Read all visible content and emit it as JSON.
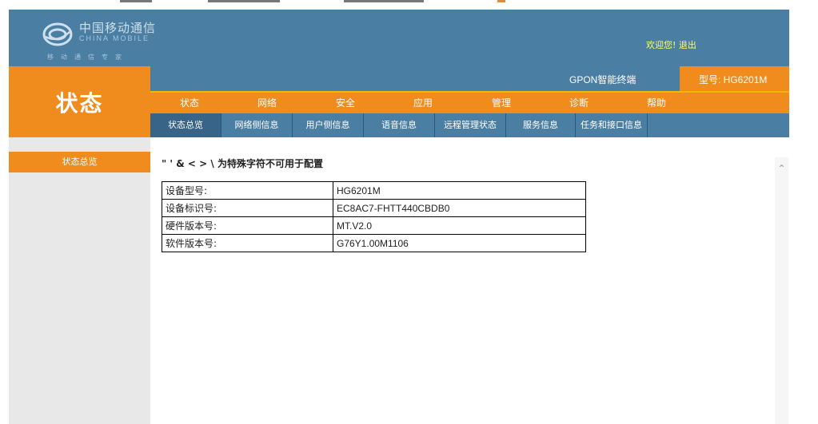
{
  "brand": {
    "name_cn": "中国移动通信",
    "name_en": "CHINA MOBILE",
    "slogan": "移动通信专家"
  },
  "header": {
    "welcome": "欢迎您!",
    "logout": "退出"
  },
  "page": {
    "title": "状态"
  },
  "product": {
    "name": "GPON智能终端",
    "model_label": "型号: HG6201M"
  },
  "main_nav": [
    "状态",
    "网络",
    "安全",
    "应用",
    "管理",
    "诊断",
    "帮助"
  ],
  "sub_nav": [
    "状态总览",
    "网络侧信息",
    "用户侧信息",
    "语音信息",
    "远程管理状态",
    "服务信息",
    "任务和接口信息"
  ],
  "sidebar": {
    "items": [
      "状态总览"
    ]
  },
  "content": {
    "notice": "\" ' & < > \\ 为特殊字符不可用于配置",
    "rows": [
      {
        "key": "设备型号:",
        "value": "HG6201M"
      },
      {
        "key": "设备标识号:",
        "value": "EC8AC7-FHTT440CBDB0"
      },
      {
        "key": "硬件版本号:",
        "value": "MT.V2.0"
      },
      {
        "key": "软件版本号:",
        "value": "G76Y1.00M1106"
      }
    ]
  },
  "colors": {
    "header_blue": "#4a7ea3",
    "accent_orange": "#f08c1e",
    "sidebar_gray": "#e8e8e8"
  }
}
